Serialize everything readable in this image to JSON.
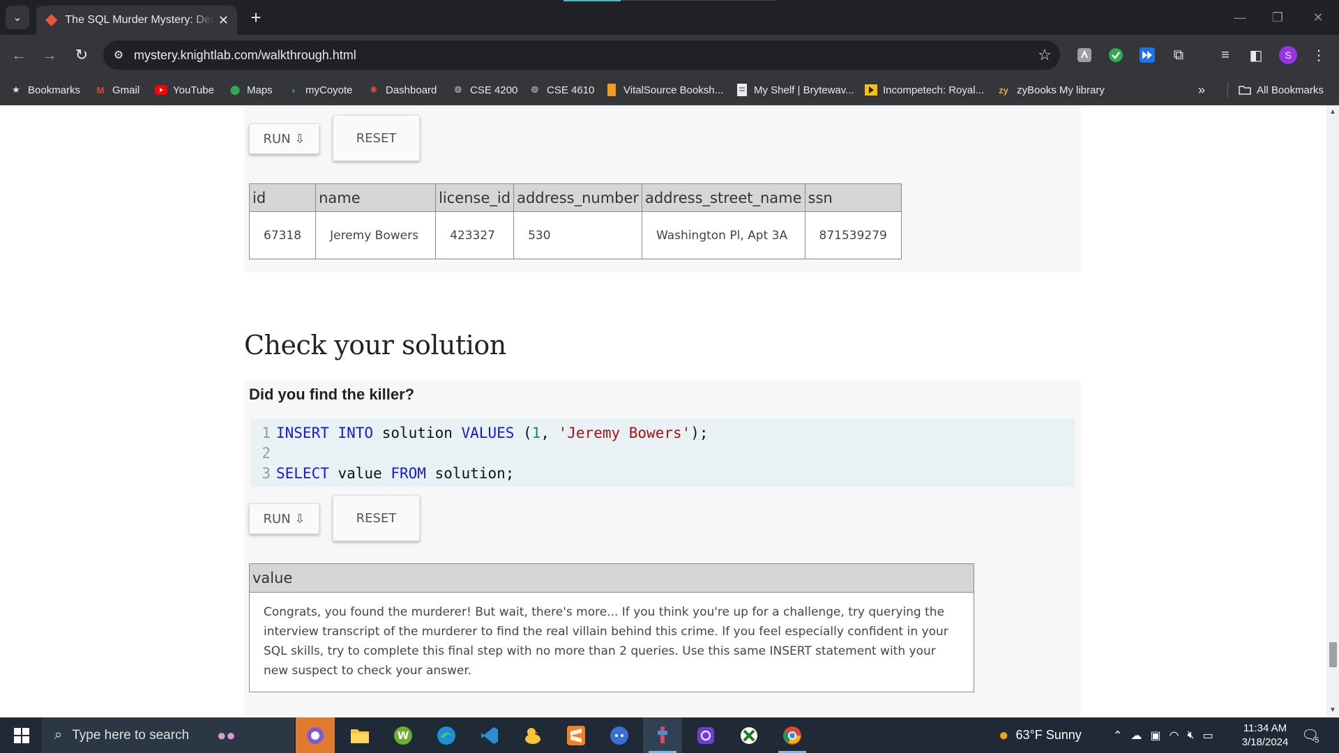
{
  "browser": {
    "tab_title": "The SQL Murder Mystery: Detai",
    "url": "mystery.knightlab.com/walkthrough.html",
    "profile_initial": "S"
  },
  "bookmarks": [
    {
      "label": "Bookmarks",
      "icon": "star-icon"
    },
    {
      "label": "Gmail",
      "icon": "gmail-icon"
    },
    {
      "label": "YouTube",
      "icon": "youtube-icon"
    },
    {
      "label": "Maps",
      "icon": "maps-icon"
    },
    {
      "label": "myCoyote",
      "icon": "mycoyote-icon"
    },
    {
      "label": "Dashboard",
      "icon": "dashboard-icon"
    },
    {
      "label": "CSE 4200",
      "icon": "globe-icon"
    },
    {
      "label": "CSE 4610",
      "icon": "globe-icon"
    },
    {
      "label": "VitalSource Booksh...",
      "icon": "vitalsource-icon"
    },
    {
      "label": "My Shelf | Brytewav...",
      "icon": "document-icon"
    },
    {
      "label": "Incompetech: Royal...",
      "icon": "incompetech-icon"
    },
    {
      "label": "zyBooks My library",
      "icon": "zybooks-icon"
    }
  ],
  "all_bookmarks": "All Bookmarks",
  "query1": {
    "run_label": "RUN ⇩",
    "reset_label": "RESET",
    "columns": [
      "id",
      "name",
      "license_id",
      "address_number",
      "address_street_name",
      "ssn"
    ],
    "row": [
      "67318",
      "Jeremy Bowers",
      "423327",
      "530",
      "Washington Pl, Apt 3A",
      "871539279"
    ]
  },
  "section": {
    "heading": "Check your solution",
    "question": "Did you find the killer?"
  },
  "editor": {
    "line_numbers": [
      "1",
      "2",
      "3"
    ]
  },
  "query2": {
    "run_label": "RUN ⇩",
    "reset_label": "RESET",
    "column": "value",
    "result": "Congrats, you found the murderer! But wait, there's more... If you think you're up for a challenge, try querying the interview transcript of the murderer to find the real villain behind this crime. If you feel especially confident in your SQL skills, try to complete this final step with no more than 2 queries. Use this same INSERT statement with your new suspect to check your answer."
  },
  "taskbar": {
    "search_placeholder": "Type here to search",
    "weather": "63°F  Sunny",
    "time": "11:34 AM",
    "date": "3/18/2024",
    "notifications": "5"
  },
  "colors": {
    "keyword": "#1a1acc",
    "number": "#1d8a3c",
    "string": "#a11",
    "editor_bg": "#e8f2f5"
  }
}
